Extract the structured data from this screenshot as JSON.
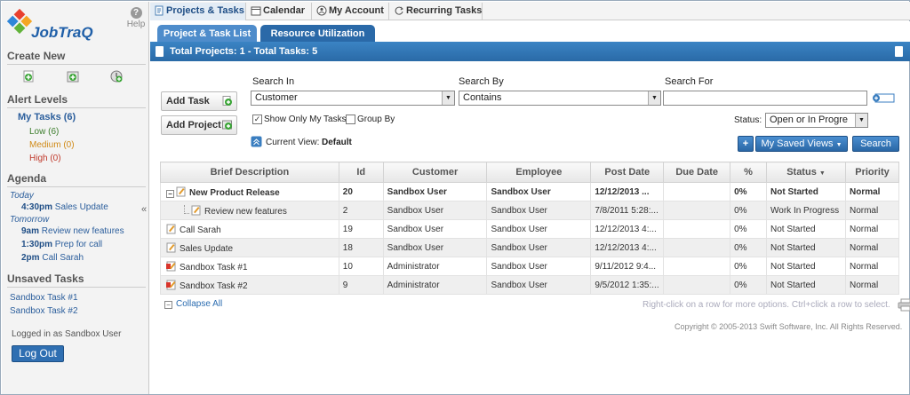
{
  "app": {
    "logo_text": "JobTraQ",
    "help": "Help"
  },
  "sidebar": {
    "create_new": "Create New",
    "alert_levels": "Alert Levels",
    "my_tasks": "My Tasks (6)",
    "low": "Low (6)",
    "medium": "Medium (0)",
    "high": "High (0)",
    "agenda": "Agenda",
    "today": "Today",
    "today_items": [
      {
        "time": "4:30pm",
        "text": "Sales Update"
      }
    ],
    "tomorrow": "Tomorrow",
    "tomorrow_items": [
      {
        "time": "9am",
        "text": "Review new features"
      },
      {
        "time": "1:30pm",
        "text": "Prep for call"
      },
      {
        "time": "2pm",
        "text": "Call Sarah"
      }
    ],
    "collapse_glyph": "«",
    "unsaved_tasks": "Unsaved Tasks",
    "unsaved_items": [
      "Sandbox Task #1",
      "Sandbox Task #2"
    ],
    "logged_in": "Logged in as Sandbox User",
    "logout": "Log Out"
  },
  "tabs": [
    {
      "label": "Projects & Tasks",
      "icon": "document-icon",
      "active": true
    },
    {
      "label": "Calendar",
      "icon": "calendar-icon"
    },
    {
      "label": "My Account",
      "icon": "account-icon"
    },
    {
      "label": "Recurring Tasks",
      "icon": "recurring-icon"
    }
  ],
  "subtabs": [
    "Project & Task List",
    "Resource Utilization"
  ],
  "summary": "Total Projects: 1 - Total Tasks: 5",
  "actions": {
    "add_task": "Add Task",
    "add_project": "Add Project"
  },
  "search": {
    "search_in_label": "Search In",
    "search_in_value": "Customer",
    "search_by_label": "Search By",
    "search_by_value": "Contains",
    "search_for_label": "Search For",
    "search_for_value": "",
    "show_only_my_tasks": "Show Only My Tasks",
    "group_by": "Group By",
    "current_view_label": "Current View:",
    "current_view_value": "Default",
    "status_label": "Status:",
    "status_value": "Open or In Progre",
    "plus": "+",
    "my_saved_views": "My Saved Views",
    "search_button": "Search"
  },
  "table": {
    "columns": [
      "Brief Description",
      "Id",
      "Customer",
      "Employee",
      "Post Date",
      "Due Date",
      "%",
      "Status",
      "Priority"
    ],
    "rows": [
      {
        "desc": "New Product Release",
        "id": "20",
        "customer": "Sandbox User",
        "employee": "Sandbox User",
        "post": "12/12/2013 ...",
        "due": "",
        "pct": "0%",
        "status": "Not Started",
        "priority": "Normal",
        "kind": "project"
      },
      {
        "desc": "Review new features",
        "id": "2",
        "customer": "Sandbox User",
        "employee": "Sandbox User",
        "post": "7/8/2011 5:28:...",
        "due": "",
        "pct": "0%",
        "status": "Work In Progress",
        "priority": "Normal",
        "kind": "subtask"
      },
      {
        "desc": "Call Sarah",
        "id": "19",
        "customer": "Sandbox User",
        "employee": "Sandbox User",
        "post": "12/12/2013 4:...",
        "due": "",
        "pct": "0%",
        "status": "Not Started",
        "priority": "Normal",
        "kind": "task"
      },
      {
        "desc": "Sales Update",
        "id": "18",
        "customer": "Sandbox User",
        "employee": "Sandbox User",
        "post": "12/12/2013 4:...",
        "due": "",
        "pct": "0%",
        "status": "Not Started",
        "priority": "Normal",
        "kind": "task"
      },
      {
        "desc": "Sandbox Task #1",
        "id": "10",
        "customer": "Administrator",
        "employee": "Sandbox User",
        "post": "9/11/2012 9:4...",
        "due": "",
        "pct": "0%",
        "status": "Not Started",
        "priority": "Normal",
        "kind": "task-red"
      },
      {
        "desc": "Sandbox Task #2",
        "id": "9",
        "customer": "Administrator",
        "employee": "Sandbox User",
        "post": "9/5/2012 1:35:...",
        "due": "",
        "pct": "0%",
        "status": "Not Started",
        "priority": "Normal",
        "kind": "task-red"
      }
    ]
  },
  "footer": {
    "collapse_all": "Collapse All",
    "hint": "Right-click on a row for more options. Ctrl+click a row to select.",
    "copyright": "Copyright © 2005-2013 Swift Software, Inc. All Rights Reserved."
  },
  "colors": {
    "accent": "#2a6aa7",
    "status_green": "#2e7d32"
  }
}
